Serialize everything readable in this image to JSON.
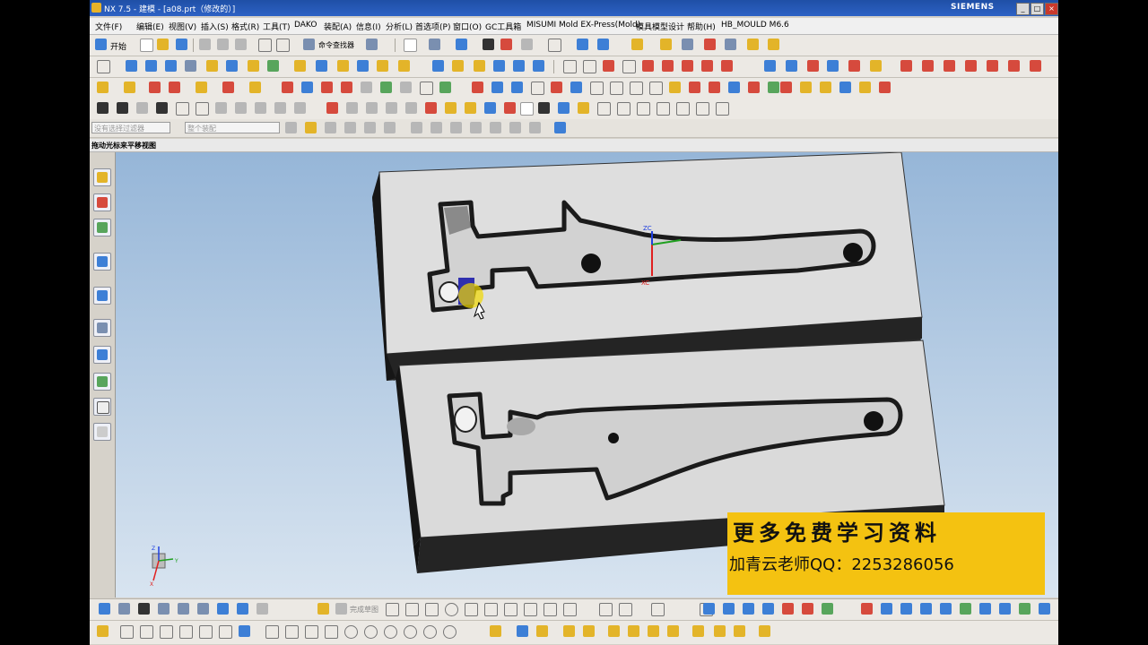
{
  "window": {
    "title": "NX 7.5 - 建模 - [a08.prt（修改的）]",
    "brand": "SIEMENS",
    "controls": [
      "_",
      "□",
      "×"
    ]
  },
  "menubar": {
    "items": [
      "文件(F)",
      "编辑(E)",
      "视图(V)",
      "插入(S)",
      "格式(R)",
      "工具(T)",
      "DAKO",
      "装配(A)",
      "信息(I)",
      "分析(L)",
      "首选项(P)",
      "窗口(O)",
      "GC工具箱",
      "MISUMI Mold EX-Press(Mold)",
      "模具模型设计",
      "帮助(H)",
      "HB_MOULD M6.6"
    ]
  },
  "toolbar1": {
    "start_label": "开始",
    "command_finder_label": "命令查找器"
  },
  "statusbar": {
    "message": "拖动光标来平移视图"
  },
  "selection_bar": {
    "filter_value": "没有选择过滤器",
    "scope_value": "整个装配"
  },
  "bottom_toolbar": {
    "curve_label": "完成草图"
  },
  "viewport": {
    "triad_x": "XC",
    "triad_z": "ZC",
    "view_triad_z": "Z",
    "view_triad_x": "X",
    "view_triad_y": "Y"
  },
  "ad_overlay": {
    "line1": "更多免费学习资料",
    "line2": "加青云老师QQ：2253286056"
  },
  "colors": {
    "titlebar": "#2d61c5",
    "ad_background": "#f4c211",
    "mold_face": "#dedede",
    "mold_side": "#2a2a2a"
  }
}
